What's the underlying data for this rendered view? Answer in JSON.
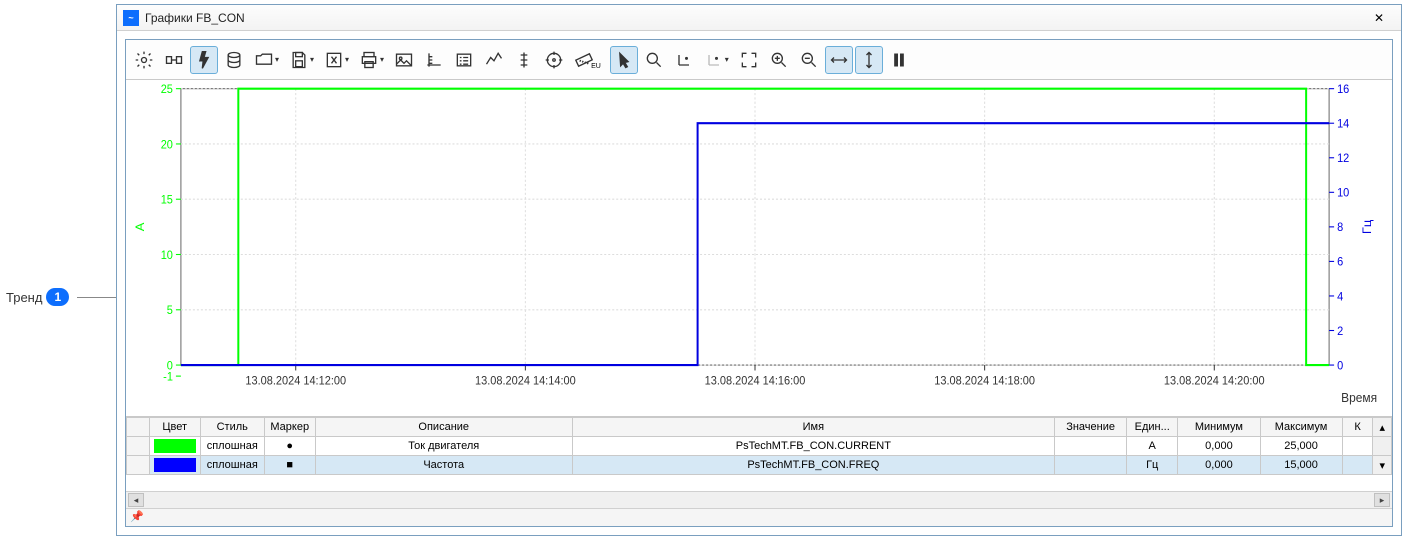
{
  "annotation": {
    "label": "Тренд",
    "badge": "1"
  },
  "window": {
    "title": "Графики FB_CON"
  },
  "chart_data": {
    "type": "line",
    "xlabel": "Время",
    "x_ticks": [
      "13.08.2024 14:12:00",
      "13.08.2024 14:14:00",
      "13.08.2024 14:16:00",
      "13.08.2024 14:18:00",
      "13.08.2024 14:20:00"
    ],
    "series": [
      {
        "name": "PsTechMT.FB_CON.CURRENT",
        "label": "Ток двигателя",
        "color": "#00ff00",
        "unit": "А",
        "ylim": [
          0,
          25
        ],
        "y_ticks": [
          -1,
          0,
          5,
          10,
          15,
          20,
          25
        ],
        "axis": "left",
        "x": [
          0,
          0.05,
          0.05,
          0.98,
          0.98,
          1.0
        ],
        "y": [
          0,
          0,
          25,
          25,
          0,
          0
        ]
      },
      {
        "name": "PsTechMT.FB_CON.FREQ",
        "label": "Частота",
        "color": "#0000e0",
        "unit": "Гц",
        "ylim": [
          0,
          16
        ],
        "y_ticks": [
          0,
          2,
          4,
          6,
          8,
          10,
          12,
          14,
          16
        ],
        "axis": "right",
        "x": [
          0,
          0.05,
          0.45,
          0.45,
          1.0
        ],
        "y": [
          0,
          0,
          0,
          14,
          14
        ]
      }
    ]
  },
  "table": {
    "headers": {
      "color": "Цвет",
      "style": "Стиль",
      "marker": "Маркер",
      "desc": "Описание",
      "name": "Имя",
      "val": "Значение",
      "unit": "Един...",
      "min": "Минимум",
      "max": "Максимум",
      "k": "К"
    },
    "rows": [
      {
        "color": "#00ff00",
        "style": "сплошная",
        "marker": "●",
        "desc": "Ток двигателя",
        "name": "PsTechMT.FB_CON.CURRENT",
        "val": "",
        "unit": "А",
        "min": "0,000",
        "max": "25,000",
        "selected": false
      },
      {
        "color": "#0000ff",
        "style": "сплошная",
        "marker": "■",
        "desc": "Частота",
        "name": "PsTechMT.FB_CON.FREQ",
        "val": "",
        "unit": "Гц",
        "min": "0,000",
        "max": "15,000",
        "selected": true
      }
    ]
  },
  "footer_icon": "📌"
}
